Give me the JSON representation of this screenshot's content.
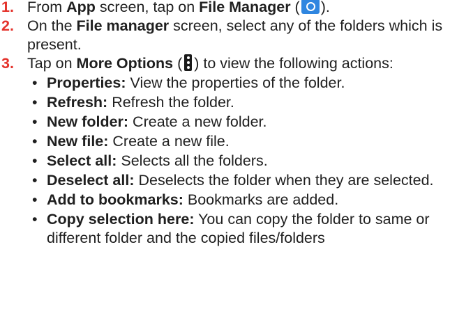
{
  "steps": [
    {
      "num": "1.",
      "t1": "From ",
      "app": "App",
      "t2": " screen, tap on ",
      "file_manager": "File Manager",
      "t3": " (",
      "t4": ")."
    },
    {
      "num": "2.",
      "t1": "On the ",
      "file_manager": "File manager",
      "t2": " screen, select any of the folders which is present."
    },
    {
      "num": "3.",
      "t1": "Tap on ",
      "more_options": "More Options",
      "t2": " (",
      "t3": ") to view the following actions:"
    }
  ],
  "icons": {
    "file_manager": "file-manager-icon",
    "more_options": "more-options-icon"
  },
  "bullet_char": "•",
  "bullets": [
    {
      "term": "Properties:",
      "desc": " View the properties of the folder."
    },
    {
      "term": "Refresh:",
      "desc": " Refresh the folder."
    },
    {
      "term": "New folder:",
      "desc": " Create a new folder."
    },
    {
      "term": "New file:",
      "desc": " Create a new file."
    },
    {
      "term": "Select all:",
      "desc": " Selects all the folders."
    },
    {
      "term": "Deselect all:",
      "desc": " Deselects the folder when they are selected."
    },
    {
      "term": "Add to bookmarks:",
      "desc": " Bookmarks are added."
    },
    {
      "term": "Copy selection here:",
      "desc": " You can copy the folder to same or different folder and the copied files/folders"
    }
  ]
}
